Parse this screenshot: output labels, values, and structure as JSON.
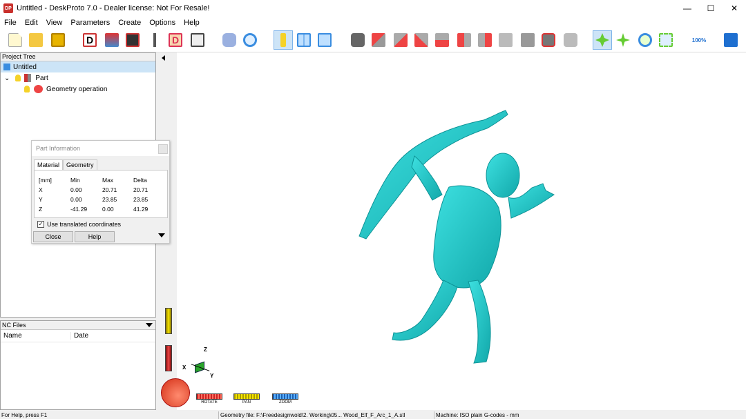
{
  "window": {
    "title": "Untitled - DeskProto 7.0 - Dealer license: Not For Resale!",
    "icon_text": "DP"
  },
  "menu": [
    "File",
    "Edit",
    "View",
    "Parameters",
    "Create",
    "Options",
    "Help"
  ],
  "toolbar": {
    "zoom_label": "100%"
  },
  "project_tree": {
    "title": "Project Tree",
    "root": "Untitled",
    "part": "Part",
    "operation": "Geometry operation"
  },
  "nc_files": {
    "title": "NC Files",
    "col_name": "Name",
    "col_date": "Date"
  },
  "part_info": {
    "title": "Part Information",
    "tabs": [
      "Material",
      "Geometry"
    ],
    "unit": "[mm]",
    "headers": [
      "Min",
      "Max",
      "Delta"
    ],
    "rows": [
      {
        "axis": "X",
        "min": "0.00",
        "max": "20.71",
        "delta": "20.71"
      },
      {
        "axis": "Y",
        "min": "0.00",
        "max": "23.85",
        "delta": "23.85"
      },
      {
        "axis": "Z",
        "min": "-41.29",
        "max": "0.00",
        "delta": "41.29"
      }
    ],
    "checkbox_label": "Use translated coordinates",
    "checkbox_checked": true,
    "close_label": "Close",
    "help_label": "Help"
  },
  "view_controls": {
    "rotate": "ROTATE",
    "pan": "PAN",
    "zoom": "ZOOM"
  },
  "axes": {
    "x": "X",
    "y": "Y",
    "z": "Z"
  },
  "statusbar": {
    "help": "For Help, press F1",
    "geometry": "Geometry file: F:\\Freedesignwold\\2. Working\\05... Wood_Elf_F_Arc_1_A.stl",
    "machine": "Machine: ISO plain G-codes - mm"
  },
  "colors": {
    "model": "#1fc4c4",
    "accent": "#0078d7",
    "selection": "#cce4f7"
  }
}
